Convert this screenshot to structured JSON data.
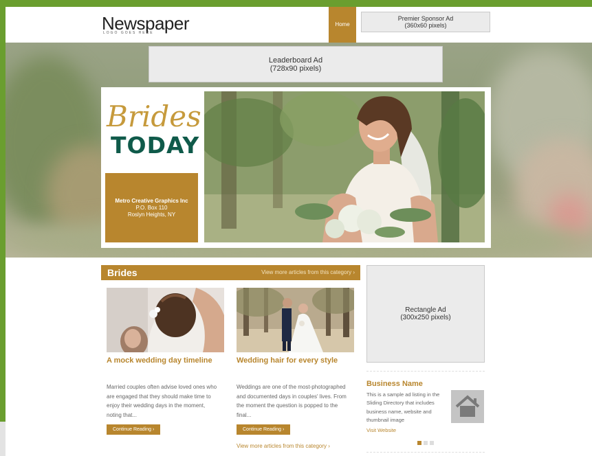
{
  "header": {
    "logo": "Newspaper",
    "tagline": "LOGO GOES HERE",
    "nav_home": "Home",
    "sponsor_ad_line1": "Premier Sponsor Ad",
    "sponsor_ad_line2": "(360x60 pixels)"
  },
  "leaderboard_ad": {
    "line1": "Leaderboard Ad",
    "line2": "(728x90 pixels)"
  },
  "banner": {
    "script_title": "Brides",
    "bold_title": "TODAY",
    "company": "Metro Creative Graphics Inc",
    "address1": "P.O. Box 110",
    "address2": "Roslyn Heights, NY"
  },
  "category": {
    "title": "Brides",
    "more": "View more articles from this category ›"
  },
  "articles": [
    {
      "title": "A mock wedding day timeline",
      "text": "Married couples often advise loved ones who are engaged that they should make time to enjoy their wedding days in the moment, noting that...",
      "button": "Continue Reading ›"
    },
    {
      "title": "Wedding hair for every style",
      "text": "Weddings are one of the most-photographed and documented days in couples' lives. From the moment the question is popped to the final...",
      "button": "Continue Reading ›"
    }
  ],
  "articles_more": "View more articles from this category ›",
  "rectangle_ad": {
    "line1": "Rectangle Ad",
    "line2": "(300x250 pixels)"
  },
  "business": {
    "name": "Business Name",
    "text": "This is a sample ad listing in the Sliding Directory that includes business name, website and thumbnail image",
    "link": "Visit Website"
  },
  "colors": {
    "frame_green": "#6a9e2f",
    "accent_gold": "#b8862e",
    "brides_green": "#0f5a4a"
  },
  "icons": [
    "home-icon"
  ]
}
